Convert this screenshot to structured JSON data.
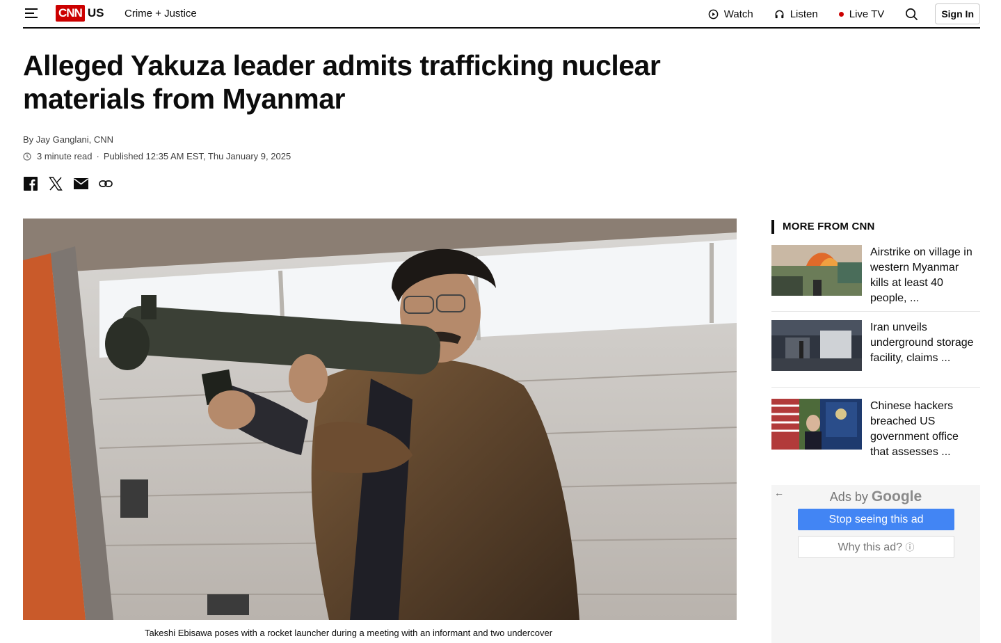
{
  "header": {
    "logo_text": "CNN",
    "edition": "US",
    "section": "Crime + Justice",
    "nav": {
      "watch": "Watch",
      "listen": "Listen",
      "live_tv": "Live TV",
      "sign_in": "Sign In"
    },
    "live_color": "#cc0000"
  },
  "article": {
    "headline": "Alleged Yakuza leader admits trafficking nuclear materials from Myanmar",
    "byline": "By Jay Ganglani, CNN",
    "read_time": "3 minute read",
    "published": "Published 12:35 AM EST, Thu January 9, 2025",
    "share_icons": [
      "facebook-icon",
      "x-icon",
      "email-icon",
      "link-icon"
    ],
    "caption": "Takeshi Ebisawa poses with a rocket launcher during a meeting with an informant and two undercover"
  },
  "sidebar": {
    "title": "MORE FROM CNN",
    "items": [
      {
        "title": "Airstrike on village in western Myanmar kills at least 40 people, ..."
      },
      {
        "title": "Iran unveils underground storage facility, claims ..."
      },
      {
        "title": "Chinese hackers breached US government office that assesses ..."
      }
    ]
  },
  "ad": {
    "ads_by": "Ads by",
    "google": "Google",
    "stop": "Stop seeing this ad",
    "why": "Why this ad?",
    "accent": "#4285f4"
  }
}
